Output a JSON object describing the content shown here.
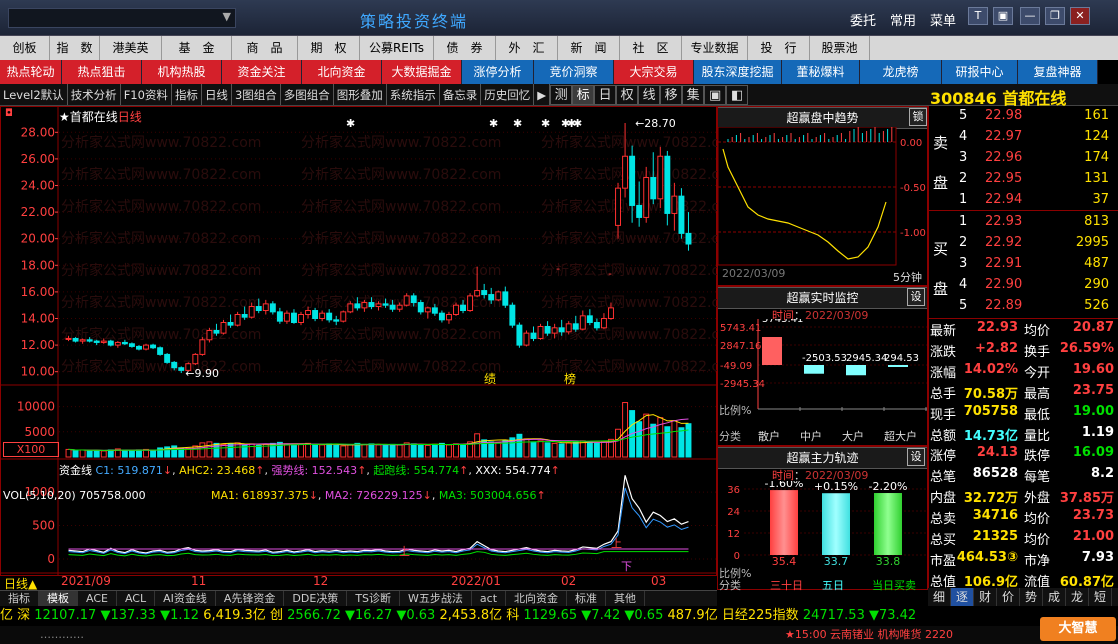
{
  "app": {
    "title": "策略投资终端",
    "menu_right": [
      "委托",
      "常用",
      "菜单"
    ],
    "window_buttons": [
      "minimize-icon",
      "restore-icon",
      "close-icon"
    ]
  },
  "menu1": [
    "创板",
    "指　数",
    "港美英",
    "基　金",
    "商　品",
    "期　权",
    "公募REITs",
    "债　券",
    "外　汇",
    "新　闻",
    "社　区",
    "专业数据",
    "投　行",
    "股票池"
  ],
  "menu2": [
    {
      "label": "热点轮动",
      "color": "#d4202a"
    },
    {
      "label": "热点狙击",
      "color": "#d4202a"
    },
    {
      "label": "机构热股",
      "color": "#d4202a"
    },
    {
      "label": "资金关注",
      "color": "#d4202a"
    },
    {
      "label": "北向资金",
      "color": "#d4202a"
    },
    {
      "label": "大数据掘金",
      "color": "#d4202a"
    },
    {
      "label": "涨停分析",
      "color": "#1569b8"
    },
    {
      "label": "竞价洞察",
      "color": "#1569b8"
    },
    {
      "label": "大宗交易",
      "color": "#d4202a"
    },
    {
      "label": "股东深度挖掘",
      "color": "#1569b8"
    },
    {
      "label": "董秘爆料",
      "color": "#1569b8"
    },
    {
      "label": "龙虎榜",
      "color": "#1569b8"
    },
    {
      "label": "研报中心",
      "color": "#1569b8"
    },
    {
      "label": "复盘神器",
      "color": "#1569b8"
    }
  ],
  "toolbar": [
    "Level2默认",
    "技术分析",
    "F10资料",
    "指标",
    "日线",
    "3图组合",
    "多图组合",
    "图形叠加",
    "系统指示",
    "备忘录",
    "历史回忆"
  ],
  "right_tabs": [
    "测",
    "标",
    "日",
    "权",
    "线",
    "移",
    "集"
  ],
  "stock": {
    "code": "300846",
    "name": "首都在线"
  },
  "chart": {
    "title": "★首都在线",
    "period": "日线",
    "high_label": "28.70",
    "low_label": "9.90",
    "price_ticks": [
      "28.00",
      "26.00",
      "24.00",
      "22.00",
      "20.00",
      "18.00",
      "16.00",
      "14.00",
      "12.00",
      "10.00"
    ],
    "markers": [
      "绩",
      "榜"
    ],
    "vol_header": {
      "name": "VOL(5,10,20)",
      "val": "705758.000",
      "ma1": "MA1: 618937.375",
      "ma2": "MA2: 726229.125",
      "ma3": "MA3: 503004.656"
    },
    "vol_ticks": [
      "10000",
      "5000"
    ],
    "vol_unit": "X100",
    "fund_header": {
      "name": "资金线",
      "c1": "C1: 519.871",
      "ahc2": "AHC2: 23.468",
      "qs": "强势线: 152.543",
      "qp": "起跑线: 554.774",
      "xxx": "XXX: 554.774"
    },
    "fund_ticks": [
      "1000",
      "500",
      "0"
    ],
    "fund_markers": [
      "上",
      "上",
      "下"
    ],
    "time_labels": [
      "日线▲",
      "2021/09",
      "11",
      "12",
      "2022/01",
      "02",
      "03"
    ]
  },
  "chart_data": {
    "type": "candlestick",
    "ylim": [
      9,
      29
    ],
    "ohlc": [
      [
        12.5,
        12.7,
        12.3,
        12.5
      ],
      [
        12.5,
        12.6,
        12.2,
        12.3
      ],
      [
        12.3,
        12.5,
        12.1,
        12.4
      ],
      [
        12.4,
        12.6,
        12.2,
        12.3
      ],
      [
        12.3,
        12.4,
        12.0,
        12.2
      ],
      [
        12.2,
        12.5,
        12.1,
        12.3
      ],
      [
        12.3,
        12.4,
        11.9,
        12.0
      ],
      [
        12.0,
        12.3,
        11.8,
        12.2
      ],
      [
        12.2,
        12.4,
        12.0,
        12.1
      ],
      [
        12.1,
        12.2,
        11.8,
        11.9
      ],
      [
        11.9,
        12.0,
        11.6,
        11.7
      ],
      [
        11.7,
        12.1,
        11.6,
        12.0
      ],
      [
        12.0,
        12.1,
        11.7,
        11.8
      ],
      [
        11.8,
        11.9,
        11.2,
        11.3
      ],
      [
        11.3,
        11.4,
        10.6,
        10.7
      ],
      [
        10.7,
        10.8,
        10.1,
        10.3
      ],
      [
        10.3,
        10.4,
        9.9,
        10.1
      ],
      [
        10.1,
        10.7,
        10.0,
        10.6
      ],
      [
        10.6,
        11.4,
        10.5,
        11.3
      ],
      [
        11.3,
        12.6,
        11.2,
        12.4
      ],
      [
        12.4,
        13.3,
        12.2,
        13.1
      ],
      [
        13.1,
        13.6,
        12.7,
        12.9
      ],
      [
        12.9,
        13.9,
        12.8,
        13.7
      ],
      [
        13.7,
        14.3,
        13.3,
        13.5
      ],
      [
        13.5,
        14.5,
        13.4,
        14.3
      ],
      [
        14.3,
        14.9,
        13.9,
        14.1
      ],
      [
        14.1,
        15.2,
        14.0,
        14.9
      ],
      [
        14.9,
        15.5,
        14.4,
        14.6
      ],
      [
        14.6,
        15.4,
        14.3,
        15.1
      ],
      [
        15.1,
        15.3,
        14.3,
        14.5
      ],
      [
        14.5,
        14.8,
        13.6,
        13.8
      ],
      [
        13.8,
        14.6,
        13.6,
        14.4
      ],
      [
        14.4,
        14.7,
        13.6,
        13.7
      ],
      [
        13.7,
        14.5,
        13.5,
        14.3
      ],
      [
        14.3,
        14.9,
        14.0,
        14.6
      ],
      [
        14.6,
        14.8,
        13.8,
        14.0
      ],
      [
        14.0,
        14.6,
        13.8,
        14.4
      ],
      [
        14.4,
        14.7,
        13.7,
        13.9
      ],
      [
        13.9,
        14.2,
        13.5,
        13.8
      ],
      [
        13.8,
        14.6,
        13.7,
        14.5
      ],
      [
        14.5,
        15.3,
        14.4,
        15.1
      ],
      [
        15.1,
        15.6,
        14.6,
        14.8
      ],
      [
        14.8,
        15.4,
        14.5,
        15.2
      ],
      [
        15.2,
        15.6,
        14.7,
        14.9
      ],
      [
        14.9,
        15.3,
        14.6,
        15.1
      ],
      [
        15.1,
        15.5,
        14.8,
        15.0
      ],
      [
        15.0,
        15.4,
        14.5,
        14.7
      ],
      [
        14.7,
        15.2,
        14.5,
        15.0
      ],
      [
        15.0,
        15.9,
        14.9,
        15.7
      ],
      [
        15.7,
        15.9,
        14.9,
        15.2
      ],
      [
        15.2,
        15.4,
        14.3,
        14.5
      ],
      [
        14.5,
        14.9,
        14.0,
        14.8
      ],
      [
        14.8,
        15.1,
        14.2,
        14.4
      ],
      [
        14.4,
        14.6,
        13.7,
        13.9
      ],
      [
        13.9,
        14.5,
        13.6,
        14.3
      ],
      [
        14.3,
        15.2,
        14.2,
        15.0
      ],
      [
        15.0,
        15.4,
        14.4,
        14.6
      ],
      [
        14.6,
        15.9,
        14.5,
        15.7
      ],
      [
        15.7,
        17.9,
        15.6,
        16.1
      ],
      [
        16.1,
        16.6,
        15.5,
        15.8
      ],
      [
        15.8,
        16.3,
        15.1,
        15.4
      ],
      [
        15.4,
        16.1,
        15.3,
        16.0
      ],
      [
        16.0,
        16.4,
        14.8,
        15.0
      ],
      [
        15.0,
        15.2,
        13.3,
        13.5
      ],
      [
        13.5,
        13.7,
        11.8,
        12.0
      ],
      [
        12.0,
        13.1,
        11.9,
        12.9
      ],
      [
        12.9,
        13.4,
        12.3,
        12.5
      ],
      [
        12.5,
        13.6,
        12.4,
        13.4
      ],
      [
        13.4,
        13.8,
        12.7,
        12.9
      ],
      [
        12.9,
        13.6,
        12.5,
        13.3
      ],
      [
        13.3,
        13.9,
        12.7,
        13.0
      ],
      [
        13.0,
        13.8,
        12.8,
        13.6
      ],
      [
        13.6,
        14.2,
        13.0,
        13.2
      ],
      [
        13.2,
        14.6,
        13.1,
        14.2
      ],
      [
        14.2,
        14.7,
        13.5,
        13.7
      ],
      [
        13.7,
        14.0,
        13.1,
        13.3
      ],
      [
        13.3,
        14.4,
        13.2,
        14.0
      ],
      [
        14.0,
        15.2,
        13.9,
        14.8
      ],
      [
        21.0,
        24.2,
        20.0,
        23.8
      ],
      [
        23.8,
        28.7,
        23.1,
        26.2
      ],
      [
        26.2,
        27.0,
        21.2,
        22.5
      ],
      [
        22.5,
        24.3,
        20.9,
        21.6
      ],
      [
        21.6,
        25.4,
        21.2,
        24.6
      ],
      [
        24.6,
        26.5,
        22.6,
        23.0
      ],
      [
        23.0,
        26.9,
        22.3,
        26.2
      ],
      [
        26.2,
        26.6,
        21.0,
        21.9
      ],
      [
        21.9,
        24.2,
        20.6,
        23.2
      ],
      [
        23.2,
        23.8,
        20.0,
        20.4
      ],
      [
        20.4,
        22.0,
        19.1,
        19.6
      ]
    ],
    "volume": [
      15,
      13,
      14,
      12,
      13,
      12,
      14,
      16,
      13,
      12,
      14,
      15,
      13,
      18,
      20,
      22,
      18,
      17,
      22,
      28,
      30,
      27,
      25,
      26,
      28,
      24,
      26,
      23,
      25,
      27,
      29,
      26,
      24,
      25,
      27,
      25,
      24,
      26,
      23,
      22,
      24,
      27,
      25,
      26,
      24,
      23,
      25,
      24,
      28,
      26,
      24,
      23,
      25,
      27,
      24,
      26,
      25,
      30,
      46,
      34,
      30,
      28,
      32,
      38,
      45,
      36,
      30,
      32,
      28,
      27,
      26,
      28,
      30,
      32,
      29,
      27,
      30,
      35,
      55,
      108,
      92,
      70,
      85,
      65,
      78,
      60,
      72,
      58,
      66
    ],
    "fund_line": [
      130,
      120,
      110,
      150,
      125,
      100,
      160,
      115,
      95,
      140,
      105,
      90,
      120,
      130,
      100,
      110,
      150,
      170,
      130,
      120,
      125,
      140,
      115,
      110,
      145,
      130,
      125,
      120,
      135,
      100,
      110,
      130,
      105,
      120,
      140,
      110,
      125,
      115,
      130,
      110,
      120,
      110,
      130,
      125,
      140,
      120,
      110,
      115,
      150,
      130,
      120,
      110,
      135,
      120,
      130,
      110,
      140,
      160,
      260,
      200,
      140,
      120,
      110,
      130,
      150,
      170,
      140,
      120,
      110,
      130,
      120,
      115,
      140,
      180,
      170,
      160,
      220,
      260,
      420,
      1250,
      900,
      760,
      550,
      700,
      650,
      560,
      600,
      520,
      560
    ]
  },
  "intraday": {
    "title": "超赢盘中趋势",
    "tab": "锁",
    "levels": [
      "0.00",
      "-0.50",
      "-1.00"
    ],
    "date": "2022/03/09",
    "period": "5分钟"
  },
  "monitor": {
    "title": "超赢实时监控",
    "set": "设",
    "time_label": "时间",
    "time": "2022/03/09",
    "ticks": [
      "5743.41",
      "2847.16",
      "-49.09",
      "-2945.34"
    ],
    "bar_labels": [
      "5743.41",
      "-2503.53",
      "2945.34",
      "294.53"
    ],
    "ratio_label": "比例%",
    "class_label": "分类",
    "classes": [
      "散户",
      "中户",
      "大户",
      "超大户"
    ]
  },
  "mainflow": {
    "title": "超赢主力轨迹",
    "set": "设",
    "time_label": "时间",
    "time": "2022/03/09",
    "pct": [
      "-1.60%",
      "+0.15%",
      "-2.20%"
    ],
    "vals": [
      "35.4",
      "33.7",
      "33.8"
    ],
    "ticks": [
      "36",
      "24",
      "12",
      "0"
    ],
    "ratio_label": "比例%",
    "class_label": "分类",
    "classes": [
      "三十日",
      "五日",
      "当日买卖"
    ]
  },
  "orderbook": {
    "sell_label": [
      "卖",
      "盘"
    ],
    "buy_label": [
      "买",
      "盘"
    ],
    "sells": [
      [
        "5",
        "22.98",
        "161"
      ],
      [
        "4",
        "22.97",
        "124"
      ],
      [
        "3",
        "22.96",
        "174"
      ],
      [
        "2",
        "22.95",
        "131"
      ],
      [
        "1",
        "22.94",
        "37"
      ]
    ],
    "buys": [
      [
        "1",
        "22.93",
        "813"
      ],
      [
        "2",
        "22.92",
        "2995"
      ],
      [
        "3",
        "22.91",
        "487"
      ],
      [
        "4",
        "22.90",
        "290"
      ],
      [
        "5",
        "22.89",
        "526"
      ]
    ]
  },
  "quote": [
    [
      "最新",
      "22.93",
      "均价",
      "20.87"
    ],
    [
      "涨跌",
      "+2.82",
      "换手",
      "26.59%"
    ],
    [
      "涨幅",
      "14.02%",
      "今开",
      "19.60"
    ],
    [
      "总手",
      "70.58万",
      "最高",
      "23.75"
    ],
    [
      "现手",
      "705758",
      "最低",
      "19.00"
    ],
    [
      "总额",
      "14.73亿",
      "量比",
      "1.19"
    ],
    [
      "涨停",
      "24.13",
      "跌停",
      "16.09"
    ],
    [
      "总笔",
      "86528",
      "每笔",
      "8.2"
    ],
    [
      "内盘",
      "32.72万",
      "外盘",
      "37.85万"
    ],
    [
      "总卖",
      "34716",
      "均价",
      "23.73"
    ],
    [
      "总买",
      "21325",
      "均价",
      "21.00"
    ],
    [
      "市盈",
      "464.53③",
      "市净",
      "7.93"
    ],
    [
      "总值",
      "106.9亿",
      "流值",
      "60.87亿"
    ]
  ],
  "quote_tabs": [
    "细",
    "逐",
    "财",
    "价",
    "势",
    "成",
    "龙",
    "短"
  ],
  "bottom_tabs": [
    "指标",
    "模板",
    "ACE",
    "ACL",
    "AI资金线",
    "A先锋资金",
    "DDE决策",
    "TS诊断",
    "W五步战法",
    "act",
    "北向资金",
    "标准",
    "其他"
  ],
  "index_bar": {
    "sh": "亿 深",
    "sz_val": "12107.17",
    "sz_chg": "▼137.33",
    "sz_pct": "▼1.12",
    "sz_amt": "6,419.3亿",
    "cy": "创",
    "cy_val": "2566.72",
    "cy_chg": "▼16.27",
    "cy_pct": "▼0.63",
    "cy_amt": "2,453.8亿",
    "kc": "科",
    "kc_val": "1129.65",
    "kc_chg": "▼7.42",
    "kc_pct": "▼0.65",
    "kc_amt": "487.9亿",
    "nk": "日经225指数",
    "nk_val": "24717.53",
    "nk_chg": "▼73.42"
  },
  "news": {
    "text": "…………",
    "right": "★15:00 云南锗业 机构唯货 2220"
  },
  "logo": "大智慧"
}
